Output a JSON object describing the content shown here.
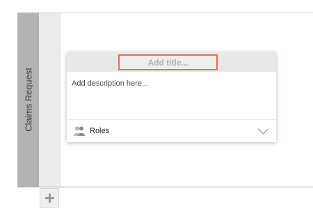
{
  "lane": {
    "title": "Claims Request"
  },
  "card": {
    "title_placeholder": "Add title...",
    "description_placeholder": "Add description here...",
    "roles_label": "Roles"
  },
  "colors": {
    "lane_header": "#b3b3b3",
    "lane_strip": "#ececec",
    "title_focus_border": "#ec6b5a",
    "card_header": "#e8e8e8"
  },
  "icons": {
    "add_lane": "plus-icon",
    "roles": "people-icon",
    "dropdown": "chevron-down-icon"
  }
}
